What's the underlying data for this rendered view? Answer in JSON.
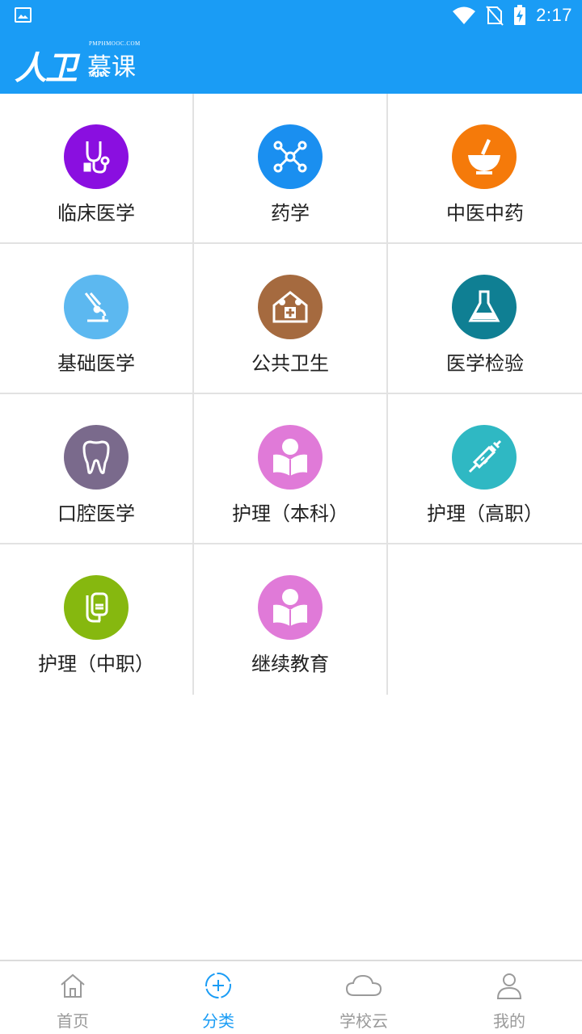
{
  "status_bar": {
    "time": "2:17"
  },
  "header": {
    "logo_main": "人卫",
    "logo_mu": "慕课",
    "logo_site": "PMPHMOOC.COM",
    "logo_mooc": "MOOC"
  },
  "categories": [
    {
      "label": "临床医学",
      "icon": "stethoscope-icon",
      "color": "#8a0fe0"
    },
    {
      "label": "药学",
      "icon": "molecule-icon",
      "color": "#1a8ff0"
    },
    {
      "label": "中医中药",
      "icon": "mortar-pestle-icon",
      "color": "#f57a0a"
    },
    {
      "label": "基础医学",
      "icon": "microscope-icon",
      "color": "#5cb8f0"
    },
    {
      "label": "公共卫生",
      "icon": "health-house-icon",
      "color": "#a56a3f"
    },
    {
      "label": "医学检验",
      "icon": "flask-icon",
      "color": "#0f7f93"
    },
    {
      "label": "口腔医学",
      "icon": "tooth-icon",
      "color": "#7a6a8c"
    },
    {
      "label": "护理（本科）",
      "icon": "reader-icon",
      "color": "#e07ad8"
    },
    {
      "label": "护理（高职）",
      "icon": "syringe-icon",
      "color": "#2fb8c3"
    },
    {
      "label": "护理（中职）",
      "icon": "iv-drip-icon",
      "color": "#86b80f"
    },
    {
      "label": "继续教育",
      "icon": "reader-icon",
      "color": "#e07ad8"
    }
  ],
  "bottom_nav": [
    {
      "label": "首页",
      "icon": "home-icon",
      "active": false
    },
    {
      "label": "分类",
      "icon": "category-plus-icon",
      "active": true
    },
    {
      "label": "学校云",
      "icon": "cloud-icon",
      "active": false
    },
    {
      "label": "我的",
      "icon": "user-icon",
      "active": false
    }
  ],
  "colors": {
    "brand": "#1a9cf5",
    "divider": "#e2e2e2",
    "inactive_nav": "#9a9a9a"
  }
}
